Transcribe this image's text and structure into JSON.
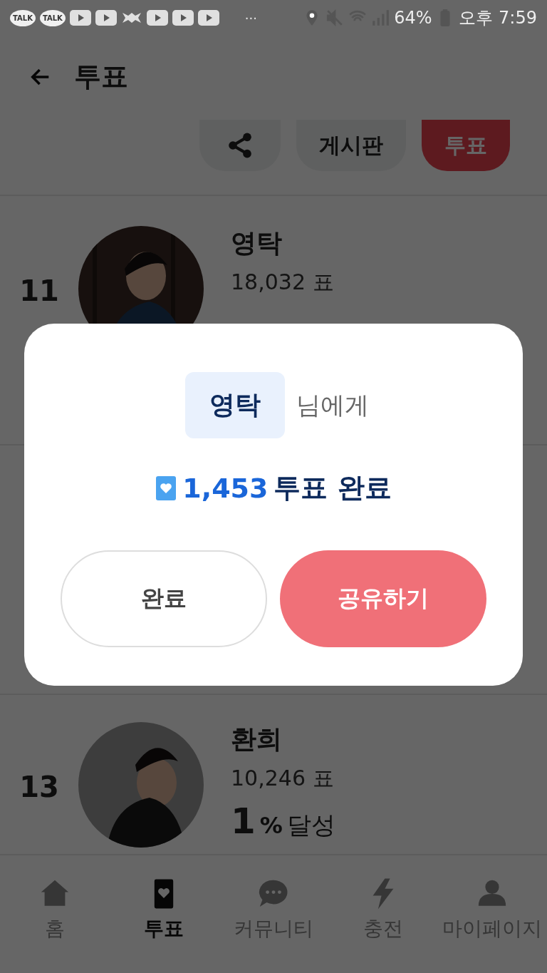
{
  "status_bar": {
    "notifications": [
      {
        "kind": "talk",
        "label": "TALK"
      },
      {
        "kind": "talk",
        "label": "TALK"
      },
      {
        "kind": "play"
      },
      {
        "kind": "play"
      },
      {
        "kind": "gear"
      },
      {
        "kind": "play"
      },
      {
        "kind": "play"
      },
      {
        "kind": "play"
      },
      {
        "kind": "more",
        "label": "···"
      }
    ],
    "battery": "64%",
    "time": "오후 7:59"
  },
  "header": {
    "title": "투표"
  },
  "actions": [
    {
      "kind": "share",
      "selected": false
    },
    {
      "kind": "text",
      "label": "게시판",
      "selected": false
    },
    {
      "kind": "text",
      "label": "투표",
      "selected": true
    }
  ],
  "rows": [
    {
      "rank": "11",
      "name": "영탁",
      "votes": "18,032 표"
    },
    {
      "rank": "13",
      "name": "환희",
      "votes": "10,246 표",
      "percent": "1",
      "percent_sign": "%",
      "percent_label": "달성"
    }
  ],
  "dialog": {
    "name": "영탁",
    "suffix": "님에게",
    "count": "1,453",
    "result": "투표 완료",
    "buttons": [
      {
        "kind": "secondary",
        "label": "완료"
      },
      {
        "kind": "primary",
        "label": "공유하기"
      }
    ]
  },
  "nav": [
    {
      "kind": "home",
      "label": "홈",
      "selected": false
    },
    {
      "kind": "vote",
      "label": "투표",
      "selected": true
    },
    {
      "kind": "community",
      "label": "커뮤니티",
      "selected": false
    },
    {
      "kind": "charge",
      "label": "충전",
      "selected": false
    },
    {
      "kind": "mypage",
      "label": "마이페이지",
      "selected": false
    }
  ]
}
